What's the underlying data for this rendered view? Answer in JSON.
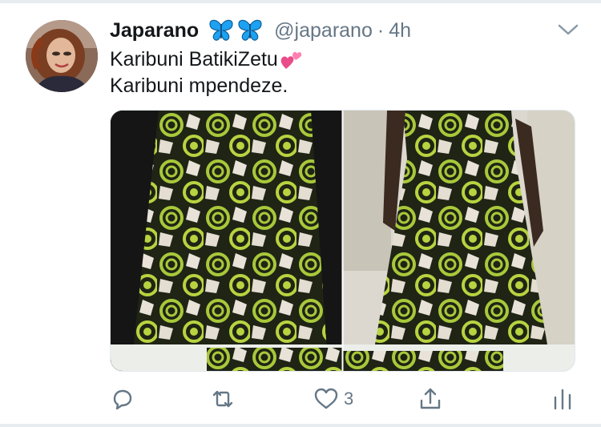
{
  "tweet": {
    "display_name": "Japarano",
    "badge_icons": [
      "butterfly-icon",
      "butterfly-icon"
    ],
    "handle": "@japarano",
    "separator": "·",
    "timestamp": "4h",
    "text_line_1": "Karibuni BatikiZetu",
    "text_emoji": "two-hearts-emoji",
    "text_line_2": "Karibuni mpendeze.",
    "media": {
      "description_icons": [
        "batik-dress-photo",
        "batik-dress-photo"
      ]
    }
  },
  "actions": {
    "reply_icon": "reply-icon",
    "retweet_icon": "retweet-icon",
    "like_icon": "heart-icon",
    "like_count": "3",
    "share_icon": "share-icon",
    "stats_icon": "stats-icon"
  },
  "colors": {
    "text": "#14171a",
    "secondary": "#657786",
    "butterfly": "#1da1f2",
    "heart_emoji": "#e0245e",
    "border": "#e6ecf0"
  }
}
